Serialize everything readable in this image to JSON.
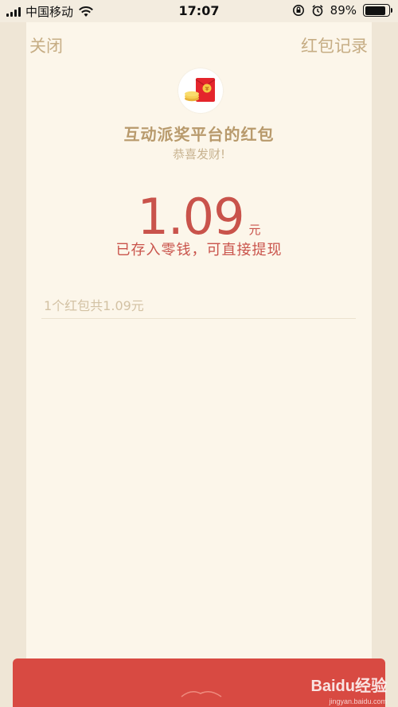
{
  "status_bar": {
    "carrier": "中国移动",
    "time": "17:07",
    "battery_percent": "89%",
    "battery_level": 0.89,
    "icons": [
      "signal-icon",
      "wifi-icon",
      "orientation-lock-icon",
      "alarm-icon",
      "battery-icon"
    ]
  },
  "nav": {
    "close_label": "关闭",
    "records_label": "红包记录"
  },
  "packet": {
    "avatar_icon": "red-envelope-coin-icon",
    "title": "互动派奖平台的红包",
    "greeting": "恭喜发财!",
    "amount": "1.09",
    "unit": "元",
    "note": "已存入零钱，可直接提现",
    "summary": "1个红包共1.09元"
  },
  "watermark": {
    "brand": "Baidu经验",
    "url": "jingyan.baidu.com"
  },
  "colors": {
    "background": "#efe6d6",
    "panel": "#fcf6ea",
    "gold_text": "#c6ad84",
    "amount_red": "#c9534b",
    "bottom_red": "#d84a42"
  }
}
